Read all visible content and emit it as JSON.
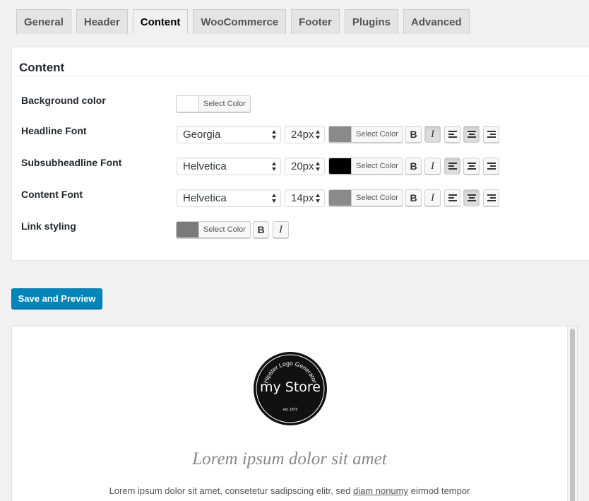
{
  "tabs": [
    {
      "label": "General"
    },
    {
      "label": "Header"
    },
    {
      "label": "Content"
    },
    {
      "label": "WooCommerce"
    },
    {
      "label": "Footer"
    },
    {
      "label": "Plugins"
    },
    {
      "label": "Advanced"
    }
  ],
  "active_tab": "Content",
  "panel": {
    "title": "Content",
    "rows": {
      "background": {
        "label": "Background color",
        "color_button": "Select Color",
        "swatch": "#ffffff"
      },
      "headline": {
        "label": "Headline Font",
        "font": "Georgia",
        "size": "24px",
        "color_button": "Select Color",
        "swatch": "#8a8a8a"
      },
      "subsubheadline": {
        "label": "Subsubheadline Font",
        "font": "Helvetica",
        "size": "20px",
        "color_button": "Select Color",
        "swatch": "#000000"
      },
      "content": {
        "label": "Content Font",
        "font": "Helvetica",
        "size": "14px",
        "color_button": "Select Color",
        "swatch": "#8a8a8a"
      },
      "link": {
        "label": "Link styling",
        "color_button": "Select Color",
        "swatch": "#7a7a7a"
      }
    },
    "bold_glyph": "B",
    "italic_glyph": "I"
  },
  "save_button": "Save and Preview",
  "preview": {
    "logo": {
      "ring_text": "Hipster Logo Generator",
      "store_name": "my Store",
      "est": "est. 1875"
    },
    "headline": "Lorem ipsum dolor sit amet",
    "text_before": "Lorem ipsum dolor sit amet, consetetur sadipscing elitr, sed ",
    "text_link": "diam nonumy",
    "text_after": " eirmod tempor"
  },
  "colors": {
    "accent": "#0085ba"
  }
}
